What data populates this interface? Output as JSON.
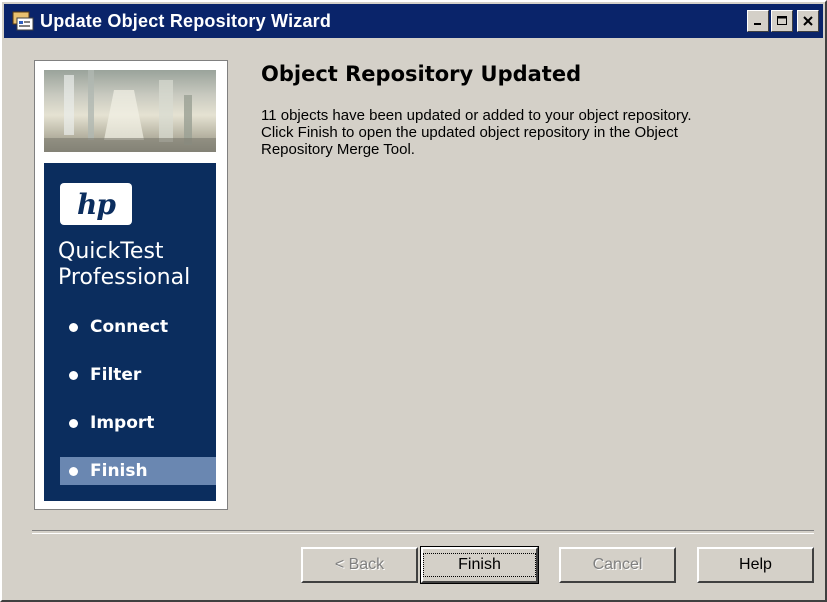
{
  "window": {
    "title": "Update Object Repository Wizard",
    "app_icon": "wizard-app-icon",
    "controls": [
      "minimize-icon",
      "maximize-icon",
      "close-icon"
    ]
  },
  "sidebar": {
    "logo_text": "hp",
    "product_line1": "QuickTest",
    "product_line2": "Professional",
    "steps": [
      {
        "label": "Connect",
        "active": false
      },
      {
        "label": "Filter",
        "active": false
      },
      {
        "label": "Import",
        "active": false
      },
      {
        "label": "Finish",
        "active": true
      }
    ]
  },
  "content": {
    "heading": "Object Repository Updated",
    "lines": [
      "11 objects have been updated or added to your object repository.",
      "Click Finish to open the updated object repository in the Object",
      "Repository Merge Tool."
    ]
  },
  "buttons": {
    "back": {
      "label": "< Back",
      "mnemonic": "B",
      "enabled": false
    },
    "finish": {
      "label": "Finish",
      "mnemonic": "F",
      "enabled": true
    },
    "cancel": {
      "label": "Cancel",
      "enabled": false
    },
    "help": {
      "label": "Help",
      "enabled": true
    }
  },
  "colors": {
    "titlebar": "#0a246a",
    "sidebar_panel": "#0b2d5e",
    "active_step": "#6a87b1",
    "window_face": "#d4d0c8"
  }
}
